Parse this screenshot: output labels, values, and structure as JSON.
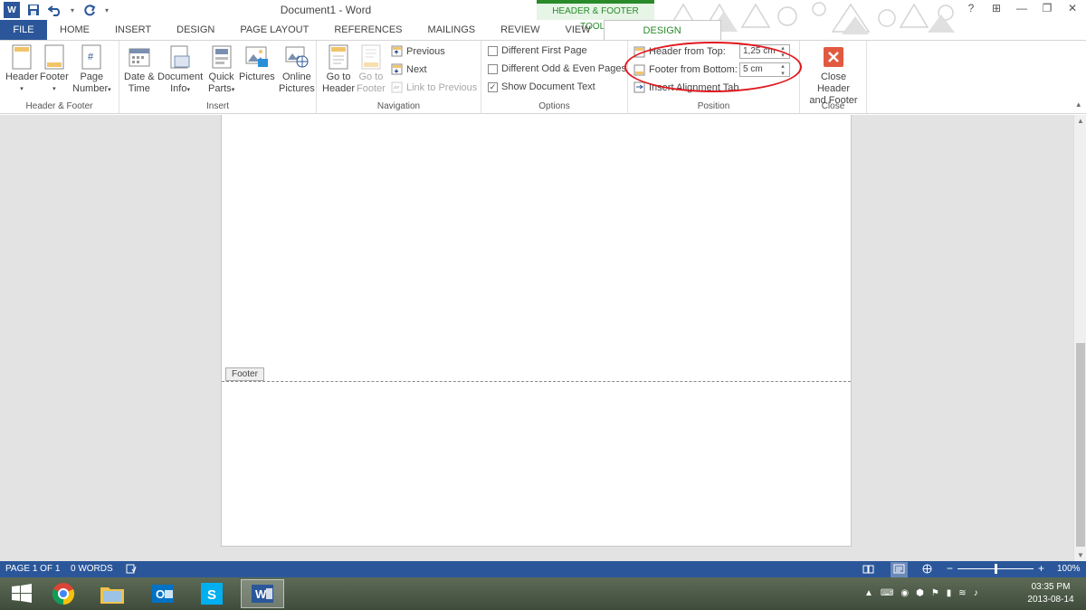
{
  "window": {
    "title": "Document1 - Word",
    "context_tab_group": "HEADER & FOOTER TOOLS"
  },
  "titlebar": {
    "help": "?",
    "ribbon_display": "⊞",
    "minimize": "—",
    "restore": "❐",
    "close": "✕"
  },
  "tabs": [
    "FILE",
    "HOME",
    "INSERT",
    "DESIGN",
    "PAGE LAYOUT",
    "REFERENCES",
    "MAILINGS",
    "REVIEW",
    "VIEW",
    "DESIGN"
  ],
  "ribbon": {
    "header_footer_group": {
      "label": "Header & Footer",
      "header": "Header",
      "footer": "Footer",
      "page_number_1": "Page",
      "page_number_2": "Number"
    },
    "insert_group": {
      "label": "Insert",
      "date_time_1": "Date &",
      "date_time_2": "Time",
      "document_info_1": "Document",
      "document_info_2": "Info",
      "quick_parts_1": "Quick",
      "quick_parts_2": "Parts",
      "pictures": "Pictures",
      "online_pictures_1": "Online",
      "online_pictures_2": "Pictures"
    },
    "navigation_group": {
      "label": "Navigation",
      "go_to_header_1": "Go to",
      "go_to_header_2": "Header",
      "go_to_footer_1": "Go to",
      "go_to_footer_2": "Footer",
      "previous": "Previous",
      "next": "Next",
      "link_to_previous": "Link to Previous"
    },
    "options_group": {
      "label": "Options",
      "different_first_page": "Different First Page",
      "different_odd_even": "Different Odd & Even Pages",
      "show_document_text": "Show Document Text",
      "different_first_page_checked": false,
      "different_odd_even_checked": false,
      "show_document_text_checked": true
    },
    "position_group": {
      "label": "Position",
      "header_from_top": "Header from Top:",
      "header_from_top_value": "1,25 cm",
      "footer_from_bottom": "Footer from Bottom:",
      "footer_from_bottom_value": "5 cm",
      "insert_alignment_tab": "Insert Alignment Tab"
    },
    "close_group": {
      "label": "Close",
      "close_1": "Close Header",
      "close_2": "and Footer"
    }
  },
  "document": {
    "footer_tag": "Footer"
  },
  "statusbar": {
    "page": "PAGE 1 OF 1",
    "words": "0 WORDS",
    "zoom_out": "−",
    "zoom_in": "+",
    "zoom": "100%",
    "zoom_level_percent": 100
  },
  "taskbar": {
    "time": "03:35 PM",
    "date": "2013-08-14"
  },
  "colors": {
    "word_blue": "#2b579a",
    "context_green": "#2a8a2a",
    "annotation_red": "#e0191f",
    "close_red": "#e15a40"
  }
}
